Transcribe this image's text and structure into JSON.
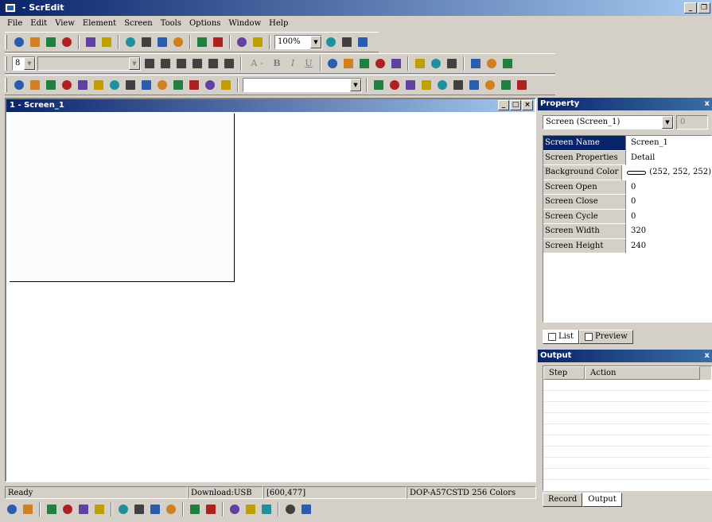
{
  "app": {
    "title": "- ScrEdit"
  },
  "menu": [
    "File",
    "Edit",
    "View",
    "Element",
    "Screen",
    "Tools",
    "Options",
    "Window",
    "Help"
  ],
  "toolbar1": {
    "buttons": [
      "new-icon",
      "open-icon",
      "save-icon",
      "export-icon",
      "undo-icon",
      "redo-icon",
      "cut-icon",
      "copy-icon",
      "paste-icon",
      "find-icon",
      "compile-icon",
      "transfer-icon",
      "print-icon",
      "help-icon"
    ],
    "zoom_value": "100%",
    "zoom_buttons": [
      "zoom-in-icon",
      "zoom-out-icon",
      "zoom-fit-icon"
    ]
  },
  "toolbar2": {
    "font_size": "8",
    "font_name": "",
    "buttons": [
      "align-left-icon",
      "align-center-icon",
      "align-right-icon",
      "align-top-icon",
      "align-middle-icon",
      "align-bottom-icon"
    ],
    "text_buttons": [
      "A -",
      "B",
      "I",
      "U"
    ],
    "extra_buttons": [
      "pen-icon",
      "fill-icon",
      "layout-icon",
      "layout-icon",
      "layout-icon",
      "grid-icon",
      "grid-icon",
      "grid-icon",
      "grid-icon",
      "grid-icon",
      "grid-icon"
    ]
  },
  "toolbar3": {
    "element_buttons": [
      "button-icon",
      "meter-icon",
      "bar-icon",
      "trend-icon",
      "pipe-icon",
      "circle-icon",
      "rect-icon",
      "graph-icon",
      "display-icon",
      "picture-icon",
      "chart-icon",
      "table-icon",
      "alarm-icon",
      "keypad-icon"
    ],
    "element_combo": "",
    "action_buttons": [
      "pointer-icon",
      "arrow-icon",
      "chart-icon",
      "prev-icon",
      "next-icon",
      "calc-icon",
      "up-icon",
      "house-icon",
      "bucket-icon",
      "ruler-icon"
    ]
  },
  "editor": {
    "title": "1 - Screen_1"
  },
  "status": {
    "ready": "Ready",
    "download": "Download:USB",
    "coords": "[600,477]",
    "model": "DOP-A57CSTD 256 Colors"
  },
  "property_panel": {
    "title": "Property",
    "object_combo": "Screen (Screen_1)",
    "spin_value": "0",
    "rows": [
      {
        "name": "Screen Name",
        "value": "Screen_1",
        "selected": true
      },
      {
        "name": "Screen Properties",
        "value": "Detail",
        "selected": false
      },
      {
        "name": "Background Color",
        "value": "(252, 252, 252)",
        "selected": false,
        "swatch": "#fcfcfc"
      },
      {
        "name": "Screen Open Macro",
        "value": "0",
        "selected": false
      },
      {
        "name": "Screen Close Macro",
        "value": "0",
        "selected": false
      },
      {
        "name": "Screen Cycle Macro",
        "value": "0",
        "selected": false
      },
      {
        "name": "Screen Width",
        "value": "320",
        "selected": false
      },
      {
        "name": "Screen Height",
        "value": "240",
        "selected": false
      }
    ],
    "tabs": [
      "List",
      "Preview"
    ]
  },
  "output_panel": {
    "title": "Output",
    "columns": [
      "Step",
      "Action"
    ],
    "tabs": [
      "Record",
      "Output"
    ]
  },
  "bottom_toolbar": [
    "group-icon",
    "ungroup-icon",
    "bring-front-icon",
    "send-back-icon",
    "forward-icon",
    "backward-icon",
    "align-icon",
    "distribute-h-icon",
    "distribute-v-icon",
    "center-icon",
    "center-v-icon",
    "center-h-icon",
    "same-width-icon",
    "same-height-icon",
    "same-size-icon",
    "fit-icon",
    "snap-icon"
  ],
  "colors": {
    "title_start": "#0a246a",
    "title_end": "#a6caf0",
    "face": "#d4d0c8",
    "selected": "#0a246a"
  }
}
